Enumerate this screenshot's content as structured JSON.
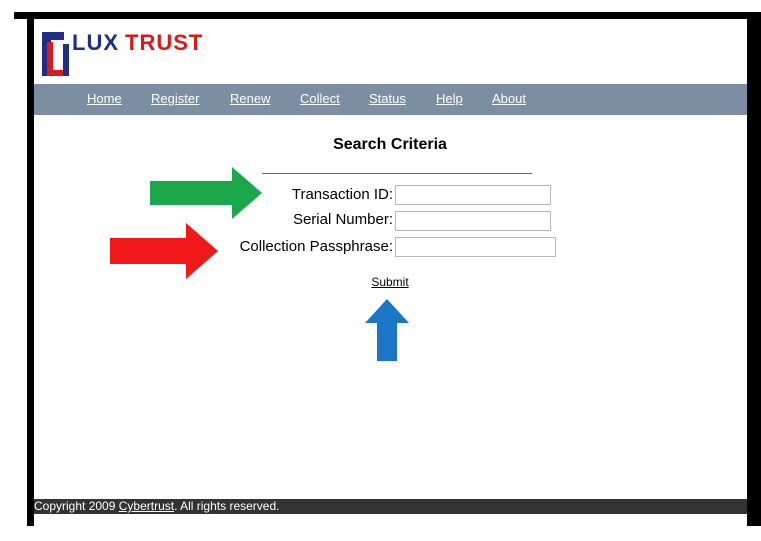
{
  "brand": {
    "name": "LUXTRUST"
  },
  "nav": {
    "home": "Home",
    "register": "Register",
    "renew": "Renew",
    "collect": "Collect",
    "status": "Status",
    "help": "Help",
    "about": "About"
  },
  "form": {
    "title": "Search Criteria",
    "transaction_id_label": "Transaction ID:",
    "serial_number_label": "Serial Number:",
    "passphrase_label": "Collection Passphrase:",
    "transaction_id_value": "",
    "serial_number_value": "",
    "passphrase_value": "",
    "submit_label": "Submit"
  },
  "annotations": {
    "transaction_arrow_color": "#1aa84b",
    "passphrase_arrow_color": "#f01818",
    "submit_arrow_color": "#1b77c6"
  },
  "footer": {
    "prefix": "Copyright 2009 ",
    "link": "Cybertrust",
    "suffix": ". All rights reserved."
  },
  "colors": {
    "nav_bg": "#7c8ea1",
    "footer_bg": "#333333",
    "logo_dark": "#1f2f86",
    "logo_red": "#d91a1a"
  }
}
